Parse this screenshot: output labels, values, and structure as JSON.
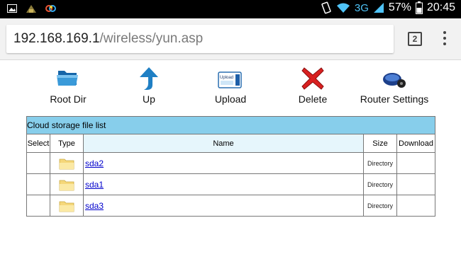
{
  "status_bar": {
    "network": "3G",
    "battery": "57%",
    "time": "20:45"
  },
  "browser": {
    "url_host": "192.168.169.1",
    "url_path": "/wireless/yun.asp",
    "tab_count": "2"
  },
  "toolbar": {
    "root_dir": "Root Dir",
    "up": "Up",
    "upload": "Upload",
    "upload_icon_text": "Upload",
    "delete": "Delete",
    "router_settings": "Router Settings"
  },
  "file_list": {
    "caption": "Cloud storage file list",
    "headers": {
      "select": "Select",
      "type": "Type",
      "name": "Name",
      "size": "Size",
      "download": "Download"
    },
    "rows": [
      {
        "name": "sda2",
        "size": "Directory",
        "icon": "folder-icon"
      },
      {
        "name": "sda1",
        "size": "Directory",
        "icon": "folder-icon"
      },
      {
        "name": "sda3",
        "size": "Directory",
        "icon": "folder-icon"
      }
    ]
  },
  "colors": {
    "caption_bg": "#87ceeb",
    "name_header_bg": "#e6f6fc",
    "link": "#0000cc"
  }
}
